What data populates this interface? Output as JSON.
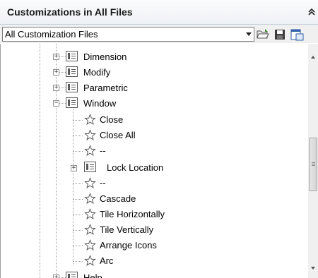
{
  "header": {
    "title": "Customizations in All Files",
    "collapse_icon": "double-chevron-up-icon"
  },
  "toolbar": {
    "selected_file": "All Customization Files",
    "buttons": [
      {
        "name": "open-file-icon"
      },
      {
        "name": "save-icon"
      },
      {
        "name": "load-partial-icon"
      }
    ]
  },
  "tree": {
    "menus": [
      {
        "label": "Dimension",
        "state": "collapsed"
      },
      {
        "label": "Modify",
        "state": "collapsed"
      },
      {
        "label": "Parametric",
        "state": "collapsed"
      },
      {
        "label": "Window",
        "state": "expanded"
      }
    ],
    "window_children": [
      {
        "label": "Close",
        "type": "command"
      },
      {
        "label": "Close All",
        "type": "command"
      },
      {
        "label": "--",
        "type": "separator"
      },
      {
        "label": "Lock Location",
        "type": "submenu"
      },
      {
        "label": "--",
        "type": "separator"
      },
      {
        "label": "Cascade",
        "type": "command"
      },
      {
        "label": "Tile Horizontally",
        "type": "command"
      },
      {
        "label": "Tile Vertically",
        "type": "command"
      },
      {
        "label": "Arrange Icons",
        "type": "command"
      },
      {
        "label": "Arc",
        "type": "command"
      }
    ],
    "trailing": {
      "label": "Help",
      "state": "collapsed"
    }
  },
  "colors": {
    "header_bg": "#eef1f5",
    "tree_line": "#a0a0a0",
    "toolbar_bg": "#f0f0f0"
  }
}
